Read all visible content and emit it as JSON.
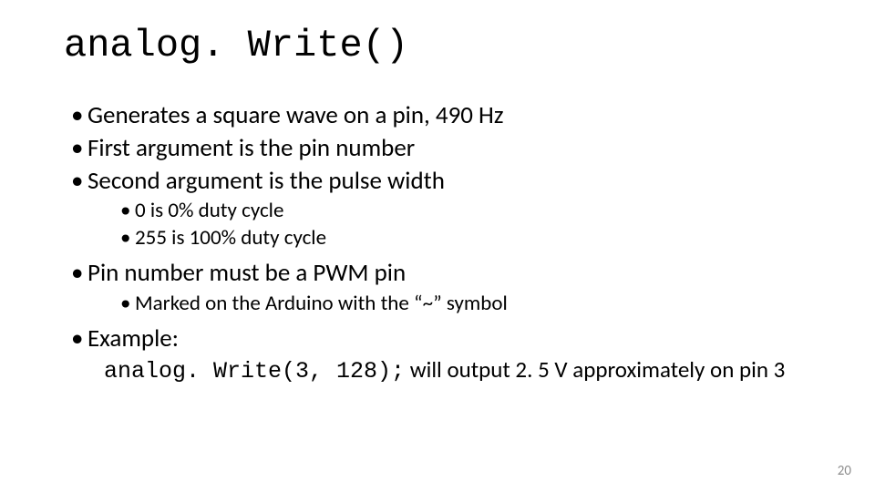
{
  "title": "analog. Write()",
  "bullets": {
    "b1": "Generates a square wave on a pin, 490 Hz",
    "b2": "First argument is the pin number",
    "b3": "Second argument is the pulse width",
    "b3_sub1": "0 is 0% duty cycle",
    "b3_sub2": "255 is 100% duty cycle",
    "b4": "Pin number must be a PWM pin",
    "b4_sub1": "Marked on the Arduino with the “~” symbol",
    "b5": "Example:"
  },
  "example": {
    "code": "analog. Write(3, 128);",
    "desc": "  will output 2. 5 V approximately on pin 3"
  },
  "page_number": "20"
}
